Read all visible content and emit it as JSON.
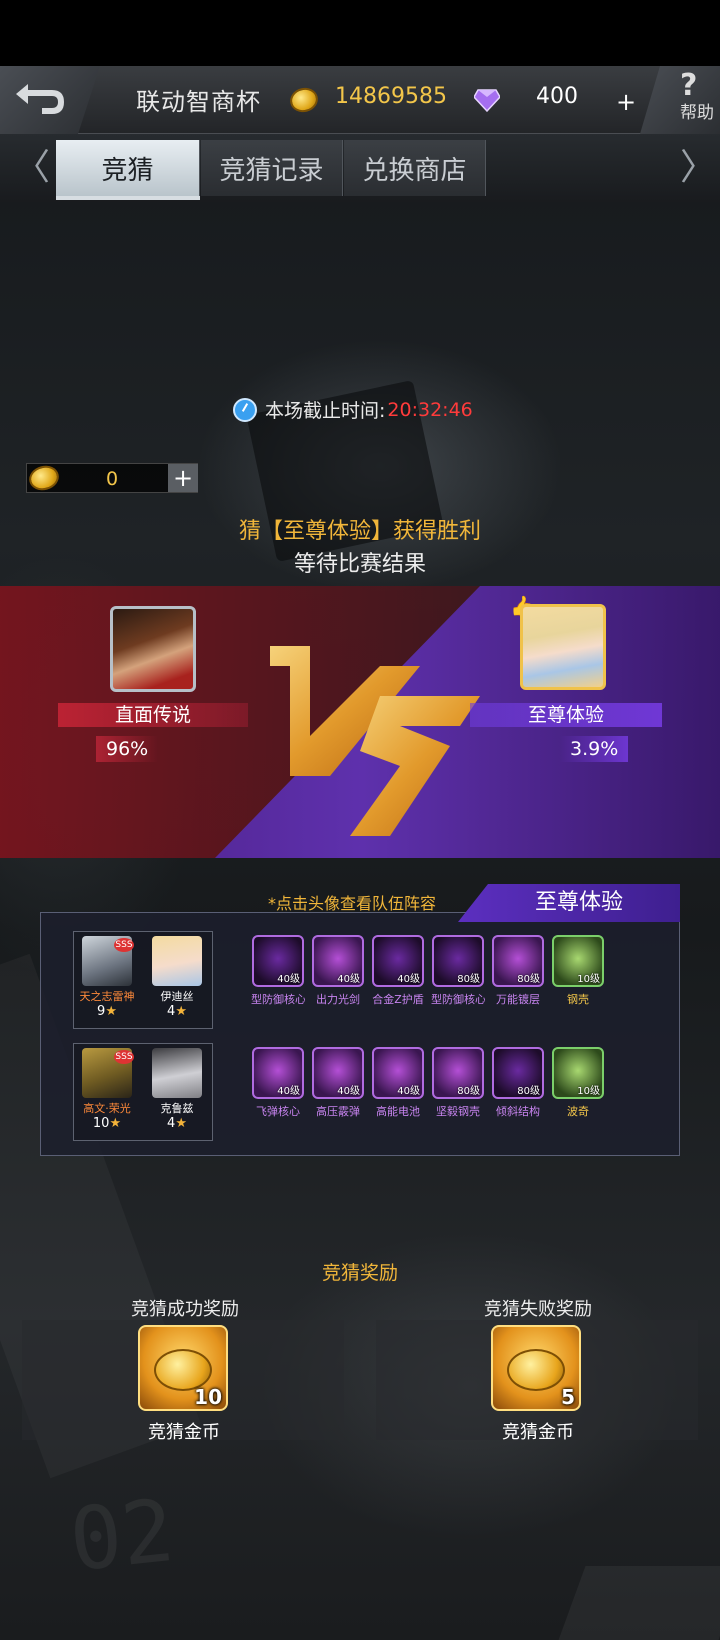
{
  "header": {
    "title": "联动智商杯",
    "gold": "14869585",
    "gems": "400",
    "gem_plus": "+",
    "help_q": "?",
    "help_label": "帮助"
  },
  "tabs": {
    "nav_left": "〈",
    "nav_right": "〉",
    "items": [
      {
        "label": "竞猜",
        "active": true
      },
      {
        "label": "竞猜记录",
        "active": false
      },
      {
        "label": "兑换商店",
        "active": false
      }
    ]
  },
  "deadline": {
    "label": "本场截止时间:",
    "time": "20:32:46"
  },
  "bet": {
    "value": "0",
    "plus": "+"
  },
  "status": {
    "guess_line": "猜【至尊体验】获得胜利",
    "wait_line": "等待比赛结果"
  },
  "match": {
    "left_team": "直面传说",
    "left_pct": "96%",
    "right_team": "至尊体验",
    "right_pct": "3.9%",
    "colors": {
      "left": "#b3202f",
      "right": "#5a30c0",
      "vs": "#e6a232"
    }
  },
  "lineup": {
    "hint": "*点击头像查看队伍阵容",
    "team_name": "至尊体验",
    "rows": [
      {
        "heroes": [
          {
            "name": "天之志雷神",
            "level": "9",
            "badge": "SSS"
          },
          {
            "name": "伊迪丝",
            "level": "4",
            "badge": ""
          }
        ],
        "items": [
          {
            "level": "40级",
            "name": "型防御核心"
          },
          {
            "level": "40级",
            "name": "出力光剑"
          },
          {
            "level": "40级",
            "name": "合金Z护盾"
          },
          {
            "level": "80级",
            "name": "型防御核心"
          },
          {
            "level": "80级",
            "name": "万能镀层"
          },
          {
            "level": "10级",
            "name": "钢壳"
          }
        ]
      },
      {
        "heroes": [
          {
            "name": "高文·荣光",
            "level": "10",
            "badge": "SSS"
          },
          {
            "name": "克鲁兹",
            "level": "4",
            "badge": ""
          }
        ],
        "items": [
          {
            "level": "40级",
            "name": "飞弹核心"
          },
          {
            "level": "40级",
            "name": "高压霰弹"
          },
          {
            "level": "40级",
            "name": "高能电池"
          },
          {
            "level": "80级",
            "name": "坚毅钢壳"
          },
          {
            "level": "80级",
            "name": "倾斜结构"
          },
          {
            "level": "10级",
            "name": "波奇"
          }
        ]
      }
    ],
    "star": "★"
  },
  "rewards": {
    "title": "竞猜奖励",
    "win": {
      "head": "竞猜成功奖励",
      "count": "10",
      "name": "竞猜金币"
    },
    "lose": {
      "head": "竞猜失败奖励",
      "count": "5",
      "name": "竞猜金币"
    }
  }
}
